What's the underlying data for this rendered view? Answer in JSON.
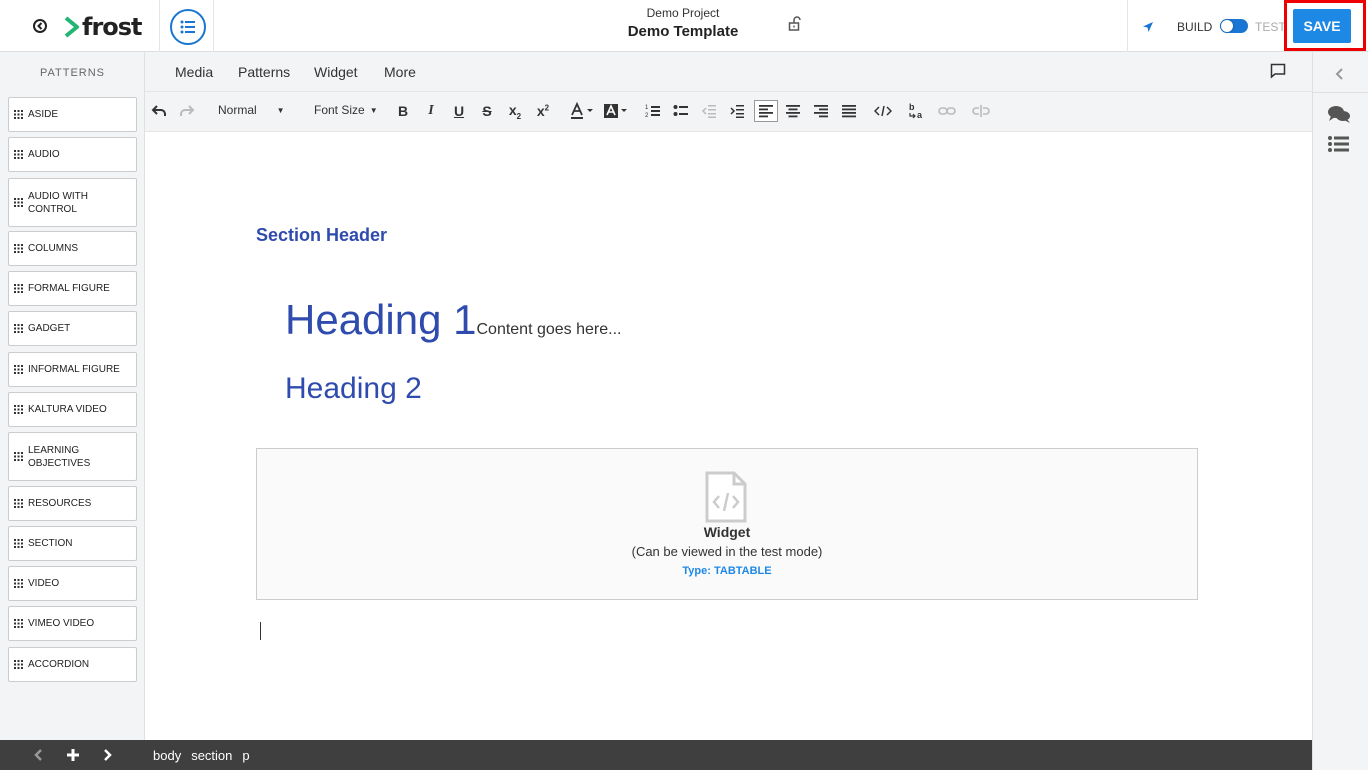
{
  "header": {
    "logo_text": "frost",
    "project_name": "Demo Project",
    "template_name": "Demo Template",
    "mode_build": "BUILD",
    "mode_test": "TEST",
    "save_label": "SAVE",
    "accent": "#1e88e5"
  },
  "sidebar": {
    "title": "PATTERNS",
    "items": [
      "ASIDE",
      "AUDIO",
      "AUDIO WITH CONTROL",
      "COLUMNS",
      "FORMAL FIGURE",
      "GADGET",
      "INFORMAL FIGURE",
      "KALTURA VIDEO",
      "LEARNING OBJECTIVES",
      "RESOURCES",
      "SECTION",
      "VIDEO",
      "VIMEO VIDEO",
      "ACCORDION"
    ]
  },
  "menu": {
    "items": [
      "Media",
      "Patterns",
      "Widget",
      "More"
    ]
  },
  "toolbar": {
    "format_select": "Normal",
    "font_size_select": "Font Size"
  },
  "editor": {
    "section_header": "Section Header",
    "heading1": "Heading 1",
    "heading1_content": "Content goes here...",
    "heading2": "Heading 2",
    "widget": {
      "title": "Widget",
      "note": "(Can be viewed in the test mode)",
      "type": "Type: TABTABLE"
    }
  },
  "statusbar": {
    "breadcrumbs": [
      "body",
      "section",
      "p"
    ]
  }
}
